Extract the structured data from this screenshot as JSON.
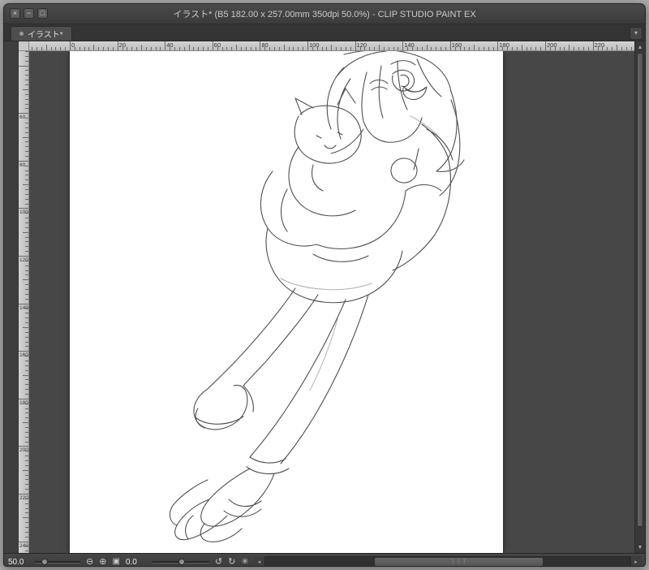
{
  "window": {
    "title": "イラスト* (B5 182.00 x 257.00mm 350dpi 50.0%)  - CLIP STUDIO PAINT EX",
    "controls": {
      "close": "×",
      "minimize": "−",
      "maximize": "□"
    }
  },
  "tabbar": {
    "active_tab": "イラスト*"
  },
  "rulers": {
    "unit": "mm",
    "horizontal_labels": [
      "0",
      "20",
      "40",
      "60",
      "80",
      "100",
      "120",
      "140",
      "160",
      "180",
      "200",
      "220"
    ],
    "vertical_labels": [
      "60",
      "80",
      "100",
      "120",
      "140",
      "160",
      "180",
      "200",
      "220",
      "240"
    ]
  },
  "statusbar": {
    "zoom_value": "50.0",
    "rotation_value": "0.0"
  },
  "icons": {
    "panel_menu": "▾",
    "zoom_out": "⊖",
    "zoom_in": "⊕",
    "fit": "▣",
    "rotate_ccw": "↺",
    "rotate_cw": "↻",
    "reset": "✳",
    "scroll_left": "◂",
    "scroll_right": "▸",
    "scroll_up": "▲",
    "scroll_down": "▼",
    "grip": "⋮⋮⋮"
  },
  "colors": {
    "titlebar": "#3f3f3f",
    "canvas_background": "#474747",
    "page": "#ffffff",
    "ruler": "#c6c6c6",
    "sketch_stroke": "#4f4f4f"
  }
}
